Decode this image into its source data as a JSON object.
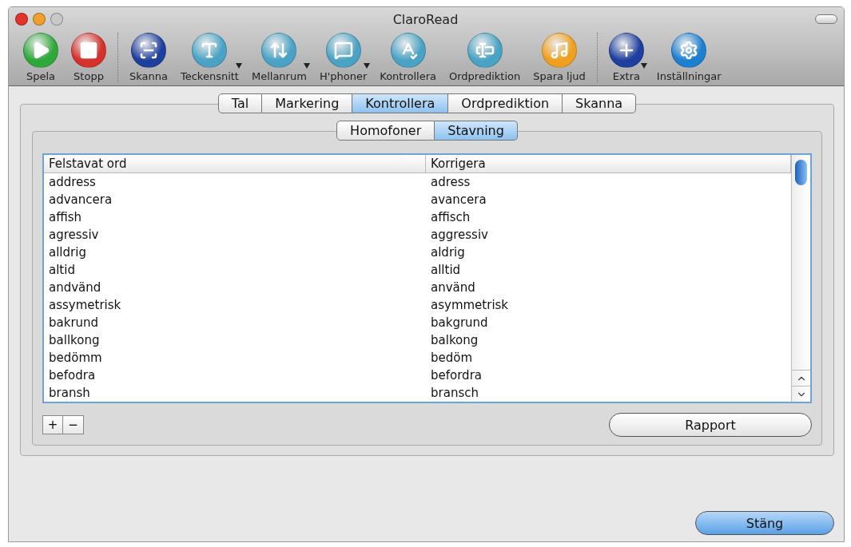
{
  "window": {
    "title": "ClaroRead"
  },
  "toolbar": {
    "groups": [
      [
        {
          "label": "Spela",
          "kind": "play",
          "color": "#2fa83a",
          "has_menu": false
        },
        {
          "label": "Stopp",
          "kind": "stop",
          "color": "#d6322c",
          "has_menu": false
        }
      ],
      [
        {
          "label": "Skanna",
          "kind": "scan",
          "color": "#1f3f9e",
          "has_menu": false
        },
        {
          "label": "Teckensnitt",
          "kind": "font",
          "color": "#4aa3c4",
          "has_menu": true
        },
        {
          "label": "Mellanrum",
          "kind": "spacing",
          "color": "#4aa3c4",
          "has_menu": true
        },
        {
          "label": "H'phoner",
          "kind": "homophones",
          "color": "#4aa3c4",
          "has_menu": true
        },
        {
          "label": "Kontrollera",
          "kind": "check",
          "color": "#4aa3c4",
          "has_menu": false
        },
        {
          "label": "Ordprediktion",
          "kind": "predict",
          "color": "#4aa3c4",
          "has_menu": false
        },
        {
          "label": "Spara ljud",
          "kind": "save-audio",
          "color": "#f0a020",
          "has_menu": false
        }
      ],
      [
        {
          "label": "Extra",
          "kind": "extra",
          "color": "#1f3f9e",
          "has_menu": true
        },
        {
          "label": "Inställningar",
          "kind": "settings",
          "color": "#1d7fd0",
          "has_menu": false
        }
      ]
    ]
  },
  "tabs": [
    {
      "label": "Tal",
      "selected": false
    },
    {
      "label": "Markering",
      "selected": false
    },
    {
      "label": "Kontrollera",
      "selected": true
    },
    {
      "label": "Ordprediktion",
      "selected": false
    },
    {
      "label": "Skanna",
      "selected": false
    }
  ],
  "subtabs": [
    {
      "label": "Homofoner",
      "selected": false
    },
    {
      "label": "Stavning",
      "selected": true
    }
  ],
  "table": {
    "columns": [
      "Felstavat ord",
      "Korrigera"
    ],
    "rows": [
      [
        "address",
        "adress"
      ],
      [
        "advancera",
        "avancera"
      ],
      [
        "affish",
        "affisch"
      ],
      [
        "agressiv",
        "aggressiv"
      ],
      [
        "alldrig",
        "aldrig"
      ],
      [
        "altid",
        "alltid"
      ],
      [
        "andvänd",
        "använd"
      ],
      [
        "assymetrisk",
        "asymmetrisk"
      ],
      [
        "bakrund",
        "bakgrund"
      ],
      [
        "ballkong",
        "balkong"
      ],
      [
        "bedömm",
        "bedöm"
      ],
      [
        "befodra",
        "befordra"
      ],
      [
        "bransh",
        "bransch"
      ]
    ]
  },
  "list_buttons": [
    "+",
    "−"
  ],
  "report_button": "Rapport",
  "close_button": "Stäng"
}
